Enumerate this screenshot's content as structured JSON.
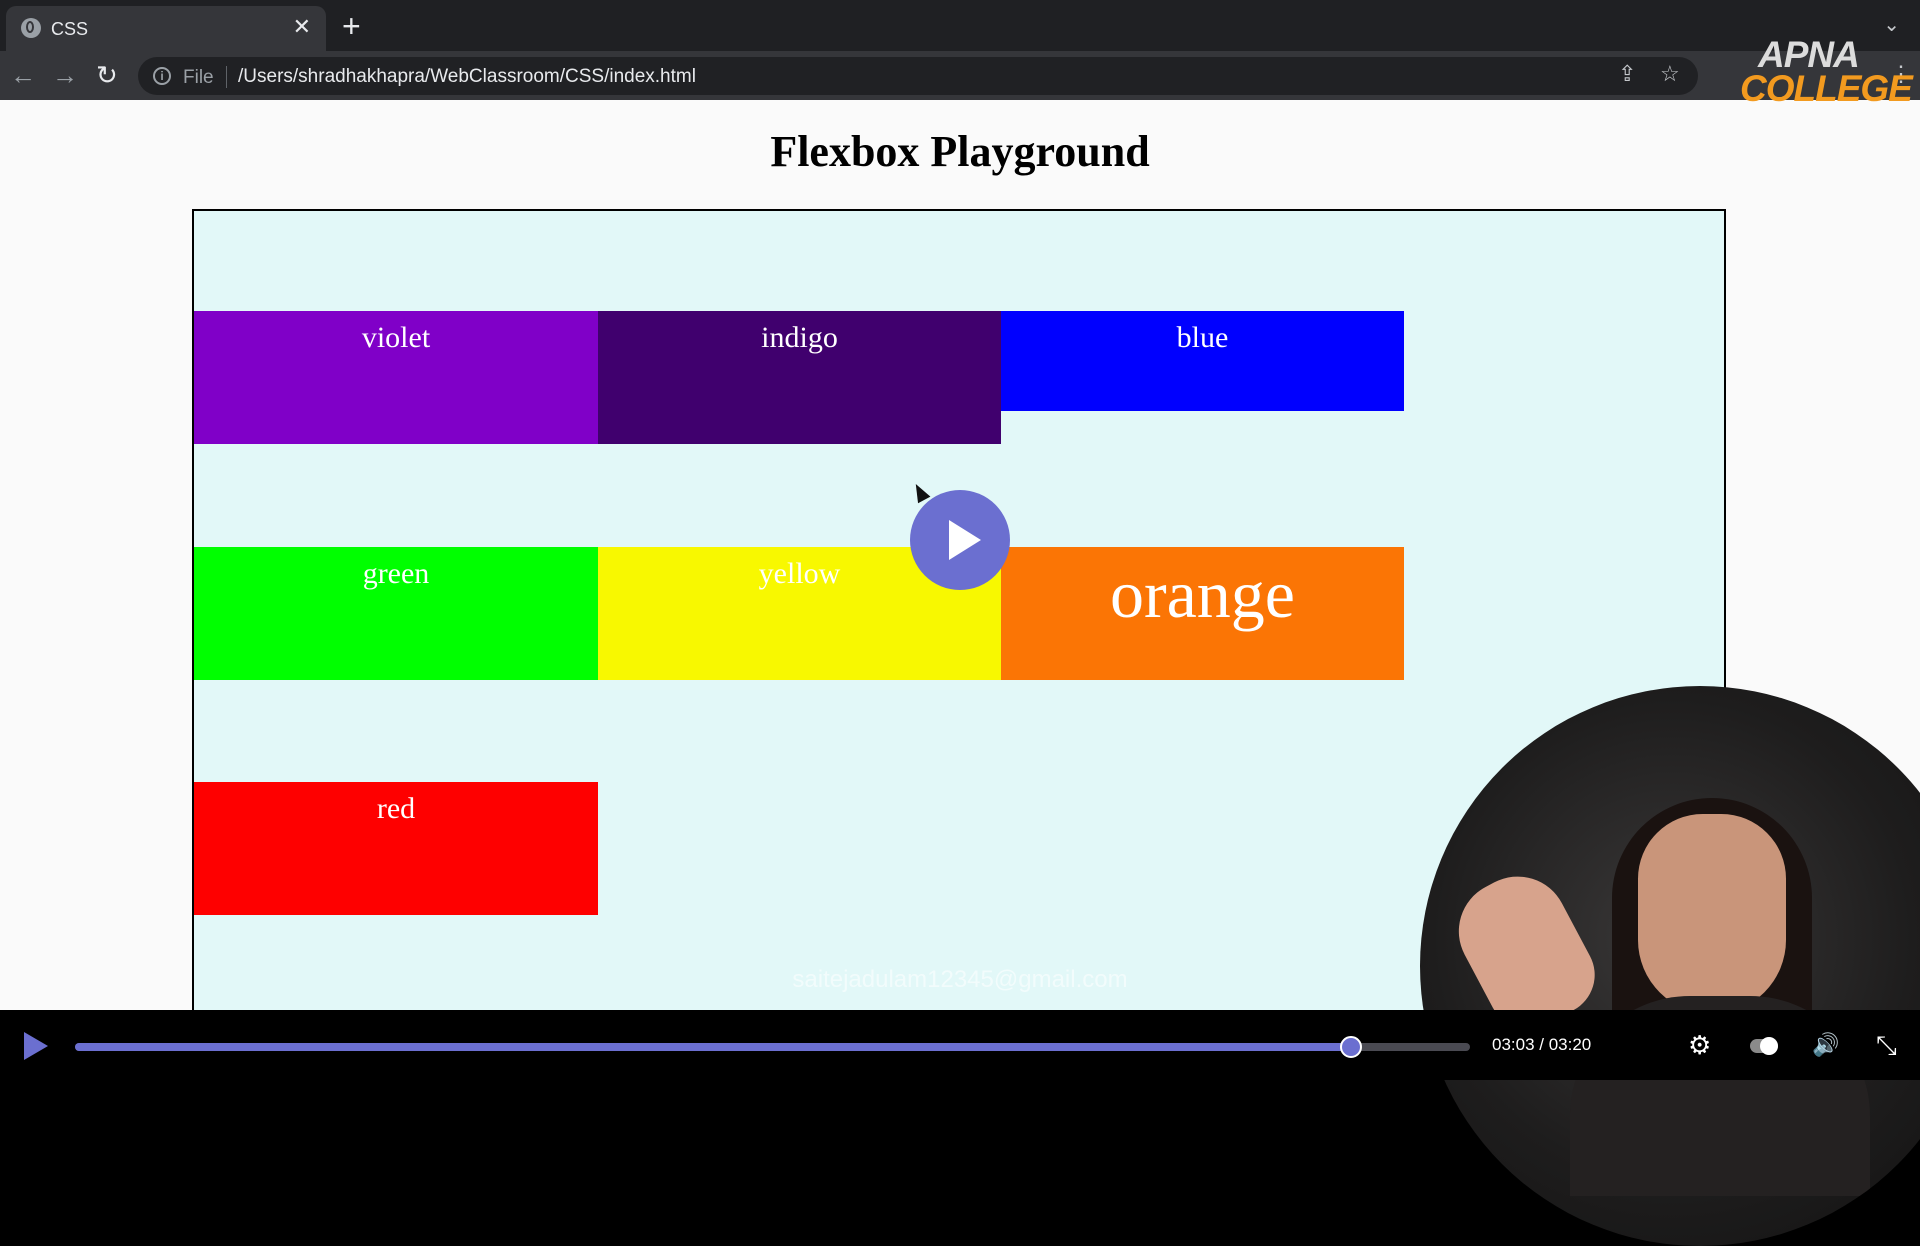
{
  "browser": {
    "tab_title": "CSS",
    "close_glyph": "✕",
    "new_tab_glyph": "+",
    "tab_menu_glyph": "⌄",
    "back_glyph": "←",
    "forward_glyph": "→",
    "reload_glyph": "↻",
    "info_glyph": "i",
    "address_scheme": "File",
    "address_url": "/Users/shradhakhapra/WebClassroom/CSS/index.html",
    "share_glyph": "⇪",
    "star_glyph": "☆",
    "menu_glyph": "⋮"
  },
  "logo": {
    "line1": "APNA",
    "line2": "COLLEGE",
    "colors": [
      "#dcdcdc",
      "#f29a1f"
    ]
  },
  "page": {
    "title": "Flexbox Playground",
    "container_background": "#e2f8f8",
    "boxes": [
      {
        "label": "violet",
        "color": "#8000c8"
      },
      {
        "label": "indigo",
        "color": "#40006e"
      },
      {
        "label": "blue",
        "color": "#0000ff"
      },
      {
        "label": "green",
        "color": "#00ff00"
      },
      {
        "label": "yellow",
        "color": "#f8f800"
      },
      {
        "label": "orange",
        "color": "#fb7505"
      },
      {
        "label": "red",
        "color": "#fe0000"
      }
    ],
    "watermark": "saitejadulam12345@gmail.com"
  },
  "video": {
    "current_time": "03:03",
    "duration": "03:20",
    "time_display": "03:03 / 03:20",
    "progress_fraction": 0.915,
    "accent": "#6b6fd0",
    "settings_glyph": "⚙",
    "volume_glyph": "🔊",
    "fullscreen_glyph": "⤡"
  }
}
